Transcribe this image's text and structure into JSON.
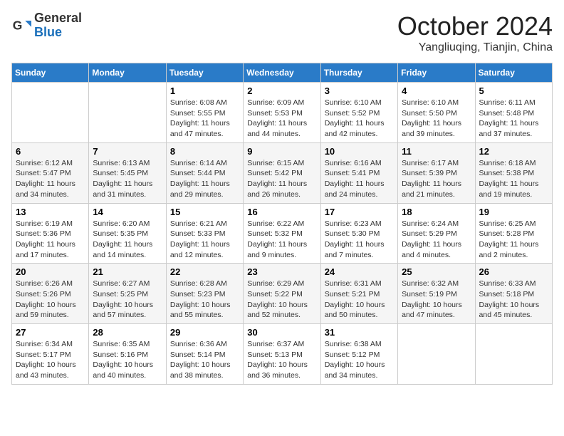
{
  "header": {
    "logo_general": "General",
    "logo_blue": "Blue",
    "month_title": "October 2024",
    "location": "Yangliuqing, Tianjin, China"
  },
  "weekdays": [
    "Sunday",
    "Monday",
    "Tuesday",
    "Wednesday",
    "Thursday",
    "Friday",
    "Saturday"
  ],
  "weeks": [
    [
      {
        "day": "",
        "info": ""
      },
      {
        "day": "",
        "info": ""
      },
      {
        "day": "1",
        "info": "Sunrise: 6:08 AM\nSunset: 5:55 PM\nDaylight: 11 hours and 47 minutes."
      },
      {
        "day": "2",
        "info": "Sunrise: 6:09 AM\nSunset: 5:53 PM\nDaylight: 11 hours and 44 minutes."
      },
      {
        "day": "3",
        "info": "Sunrise: 6:10 AM\nSunset: 5:52 PM\nDaylight: 11 hours and 42 minutes."
      },
      {
        "day": "4",
        "info": "Sunrise: 6:10 AM\nSunset: 5:50 PM\nDaylight: 11 hours and 39 minutes."
      },
      {
        "day": "5",
        "info": "Sunrise: 6:11 AM\nSunset: 5:48 PM\nDaylight: 11 hours and 37 minutes."
      }
    ],
    [
      {
        "day": "6",
        "info": "Sunrise: 6:12 AM\nSunset: 5:47 PM\nDaylight: 11 hours and 34 minutes."
      },
      {
        "day": "7",
        "info": "Sunrise: 6:13 AM\nSunset: 5:45 PM\nDaylight: 11 hours and 31 minutes."
      },
      {
        "day": "8",
        "info": "Sunrise: 6:14 AM\nSunset: 5:44 PM\nDaylight: 11 hours and 29 minutes."
      },
      {
        "day": "9",
        "info": "Sunrise: 6:15 AM\nSunset: 5:42 PM\nDaylight: 11 hours and 26 minutes."
      },
      {
        "day": "10",
        "info": "Sunrise: 6:16 AM\nSunset: 5:41 PM\nDaylight: 11 hours and 24 minutes."
      },
      {
        "day": "11",
        "info": "Sunrise: 6:17 AM\nSunset: 5:39 PM\nDaylight: 11 hours and 21 minutes."
      },
      {
        "day": "12",
        "info": "Sunrise: 6:18 AM\nSunset: 5:38 PM\nDaylight: 11 hours and 19 minutes."
      }
    ],
    [
      {
        "day": "13",
        "info": "Sunrise: 6:19 AM\nSunset: 5:36 PM\nDaylight: 11 hours and 17 minutes."
      },
      {
        "day": "14",
        "info": "Sunrise: 6:20 AM\nSunset: 5:35 PM\nDaylight: 11 hours and 14 minutes."
      },
      {
        "day": "15",
        "info": "Sunrise: 6:21 AM\nSunset: 5:33 PM\nDaylight: 11 hours and 12 minutes."
      },
      {
        "day": "16",
        "info": "Sunrise: 6:22 AM\nSunset: 5:32 PM\nDaylight: 11 hours and 9 minutes."
      },
      {
        "day": "17",
        "info": "Sunrise: 6:23 AM\nSunset: 5:30 PM\nDaylight: 11 hours and 7 minutes."
      },
      {
        "day": "18",
        "info": "Sunrise: 6:24 AM\nSunset: 5:29 PM\nDaylight: 11 hours and 4 minutes."
      },
      {
        "day": "19",
        "info": "Sunrise: 6:25 AM\nSunset: 5:28 PM\nDaylight: 11 hours and 2 minutes."
      }
    ],
    [
      {
        "day": "20",
        "info": "Sunrise: 6:26 AM\nSunset: 5:26 PM\nDaylight: 10 hours and 59 minutes."
      },
      {
        "day": "21",
        "info": "Sunrise: 6:27 AM\nSunset: 5:25 PM\nDaylight: 10 hours and 57 minutes."
      },
      {
        "day": "22",
        "info": "Sunrise: 6:28 AM\nSunset: 5:23 PM\nDaylight: 10 hours and 55 minutes."
      },
      {
        "day": "23",
        "info": "Sunrise: 6:29 AM\nSunset: 5:22 PM\nDaylight: 10 hours and 52 minutes."
      },
      {
        "day": "24",
        "info": "Sunrise: 6:31 AM\nSunset: 5:21 PM\nDaylight: 10 hours and 50 minutes."
      },
      {
        "day": "25",
        "info": "Sunrise: 6:32 AM\nSunset: 5:19 PM\nDaylight: 10 hours and 47 minutes."
      },
      {
        "day": "26",
        "info": "Sunrise: 6:33 AM\nSunset: 5:18 PM\nDaylight: 10 hours and 45 minutes."
      }
    ],
    [
      {
        "day": "27",
        "info": "Sunrise: 6:34 AM\nSunset: 5:17 PM\nDaylight: 10 hours and 43 minutes."
      },
      {
        "day": "28",
        "info": "Sunrise: 6:35 AM\nSunset: 5:16 PM\nDaylight: 10 hours and 40 minutes."
      },
      {
        "day": "29",
        "info": "Sunrise: 6:36 AM\nSunset: 5:14 PM\nDaylight: 10 hours and 38 minutes."
      },
      {
        "day": "30",
        "info": "Sunrise: 6:37 AM\nSunset: 5:13 PM\nDaylight: 10 hours and 36 minutes."
      },
      {
        "day": "31",
        "info": "Sunrise: 6:38 AM\nSunset: 5:12 PM\nDaylight: 10 hours and 34 minutes."
      },
      {
        "day": "",
        "info": ""
      },
      {
        "day": "",
        "info": ""
      }
    ]
  ]
}
